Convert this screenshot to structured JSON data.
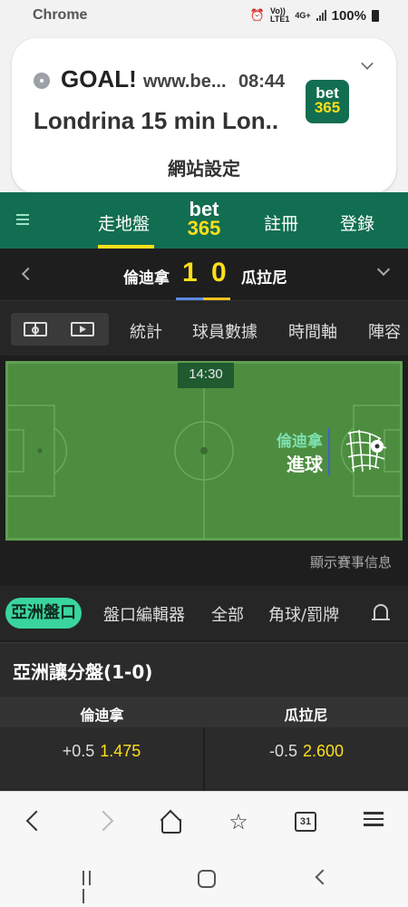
{
  "status_bar": {
    "app": "Chrome",
    "lte_top": "Vo))",
    "lte_bottom": "LTE1",
    "network": "4G+",
    "battery": "100%"
  },
  "notification": {
    "title": "GOAL!",
    "site": "www.be...",
    "time": "08:44",
    "body": "Londrina 15 min Lon..",
    "action": "網站設定",
    "logo_top": "bet",
    "logo_bottom": "365"
  },
  "nav": {
    "live": "走地盤",
    "logo_top": "bet",
    "logo_bottom": "365",
    "register": "註冊",
    "login": "登錄"
  },
  "match": {
    "home": "倫迪拿",
    "home_score": "1",
    "away_score": "0",
    "away": "瓜拉尼"
  },
  "match_tabs": [
    "統計",
    "球員數據",
    "時間軸",
    "陣容"
  ],
  "pitch": {
    "clock": "14:30",
    "event_team": "倫迪拿",
    "event_text": "進球"
  },
  "show_info": "顯示賽事信息",
  "market_tabs": {
    "active": "亞洲盤口",
    "items": [
      "盤口編輯器",
      "全部",
      "角球/罰牌"
    ]
  },
  "market": {
    "title": "亞洲讓分盤(1-0)",
    "col_home": "倫迪拿",
    "col_away": "瓜拉尼",
    "home_handicap": "+0.5",
    "home_price": "1.475",
    "away_handicap": "-0.5",
    "away_price": "2.600"
  },
  "browser": {
    "tab_count": "31"
  },
  "colors": {
    "brand_green": "#126e51",
    "accent_yellow": "#ffdf1b",
    "active_tab": "#3ad59e",
    "pitch": "#4c8d3f"
  }
}
